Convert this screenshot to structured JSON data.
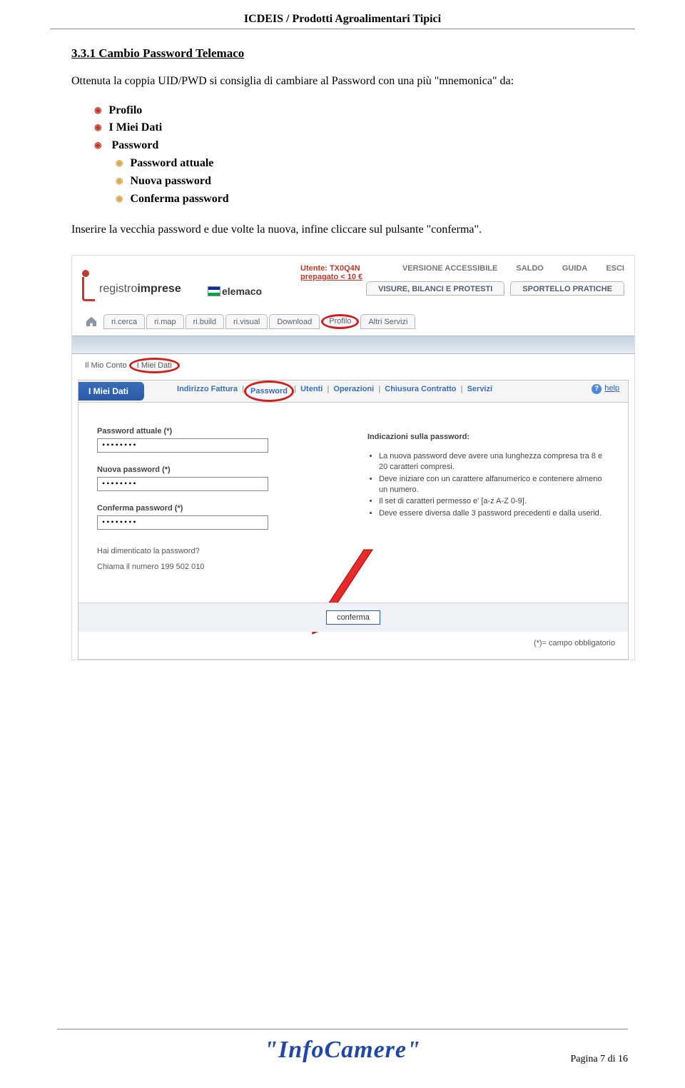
{
  "header_title": "ICDEIS / Prodotti Agroalimentari Tipici",
  "section_number": "3.3.1 Cambio Password Telemaco",
  "intro_text": "Ottenuta la coppia UID/PWD si consiglia di cambiare al Password con una più \"mnemonica\" da:",
  "bullets": {
    "profilo": "Profilo",
    "miei_dati": "I Miei Dati",
    "password": "Password",
    "pw_attuale": "Password attuale",
    "pw_nuova": "Nuova password",
    "pw_conferma": "Conferma password"
  },
  "instruction": "Inserire la vecchia password e due volte la nuova, infine cliccare sul pulsante \"conferma\".",
  "screenshot": {
    "user_line1": "Utente: TX0Q4N",
    "user_line2": "prepagato < 10 €",
    "logo_text_prefix": "registro",
    "logo_text_bold": "imprese",
    "telemaco": "elemaco",
    "top_links": {
      "versione": "VERSIONE ACCESSIBILE",
      "saldo": "SALDO",
      "guida": "GUIDA",
      "esci": "ESCI"
    },
    "subtabs": {
      "visure": "VISURE, BILANCI E PROTESTI",
      "sportello": "SPORTELLO PRATICHE"
    },
    "nav": {
      "cerca": "ri.cerca",
      "map": "ri.map",
      "build": "ri.build",
      "visual": "ri.visual",
      "download": "Download",
      "profilo": "Profilo",
      "altri": "Altri Servizi"
    },
    "mio_conto": "Il Mio Conto",
    "miei_dati_tab": "I Miei Dati",
    "panel_title": "I Miei Dati",
    "panel_tabs": {
      "indirizzo": "Indirizzo Fattura",
      "password": "Password",
      "utenti": "Utenti",
      "operazioni": "Operazioni",
      "chiusura": "Chiusura Contratto",
      "servizi": "Servizi"
    },
    "help": "help",
    "form": {
      "lbl_attuale": "Password attuale (*)",
      "lbl_nuova": "Nuova password (*)",
      "lbl_conferma": "Conferma password (*)",
      "masked": "••••••••",
      "forgot": "Hai dimenticato la password?",
      "call": "Chiama il numero 199 502 010",
      "ind_title": "Indicazioni sulla password:",
      "ind_1": "La nuova password deve avere una lunghezza compresa tra 8 e 20 caratteri compresi.",
      "ind_2": "Deve iniziare con un carattere alfanumerico e contenere almeno un numero.",
      "ind_3": "Il set di caratteri permesso e' [a-z A-Z 0-9].",
      "ind_4": "Deve essere diversa dalle 3 password precedenti e dalla userid.",
      "confirm": "conferma",
      "mandatory": "(*)= campo obbligatorio"
    }
  },
  "footer_logo": "\"InfoCamere\"",
  "page_number": "Pagina 7 di 16"
}
